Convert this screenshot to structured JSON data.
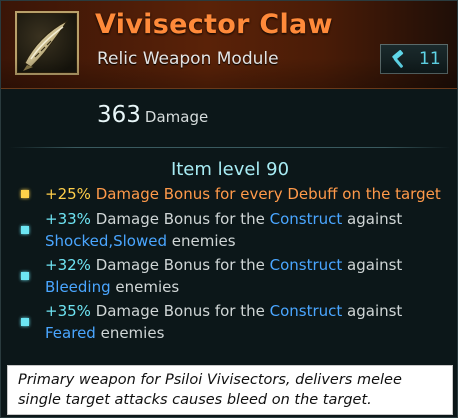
{
  "item": {
    "name": "Vivisector Claw",
    "type": "Relic Weapon Module",
    "icon": "claw-weapon-icon",
    "tech_level": "11",
    "tech_icon": "hammer-icon"
  },
  "stats": {
    "damage_value": "363",
    "damage_label": "Damage",
    "item_level": "Item level 90"
  },
  "bonuses": [
    {
      "bullet_color": "#ffd24a",
      "percent": "+25%",
      "text": " Damage Bonus for every Debuff on the target"
    },
    {
      "bullet_color": "#6de6f4",
      "percent": "+33%",
      "pre": " Damage Bonus for the ",
      "link": "Construct",
      "mid": " against",
      "cond": "Shocked,Slowed",
      "post": " enemies"
    },
    {
      "bullet_color": "#6de6f4",
      "percent": "+32%",
      "pre": " Damage Bonus for the ",
      "link": "Construct",
      "mid": " against",
      "cond": "Bleeding",
      "post": " enemies"
    },
    {
      "bullet_color": "#6de6f4",
      "percent": "+35%",
      "pre": " Damage Bonus for the ",
      "link": "Construct",
      "mid": " against",
      "cond": "Feared",
      "post": " enemies"
    }
  ],
  "description": "Primary weapon for Psiloi Vivisectors, delivers melee single target attacks causes bleed on the target.",
  "colors": {
    "name": "#ff8a3a",
    "header_bg": "#5a2208",
    "tooltip_bg": "#0c1719",
    "percent": "#6ee3f2",
    "construct_link": "#4aa6ff",
    "gold_bonus": "#ff9a4a"
  }
}
